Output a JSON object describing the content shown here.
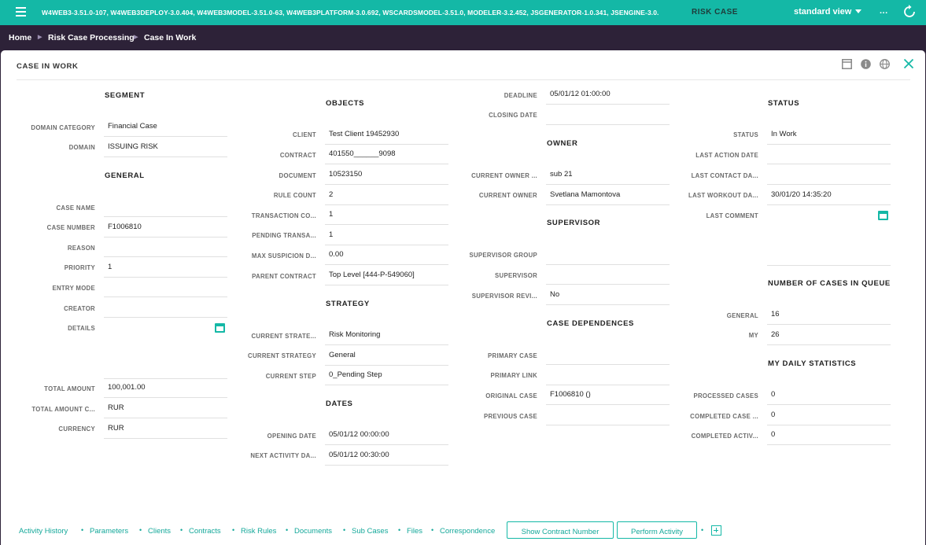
{
  "topbar": {
    "versions": "W4WEB3-3.51.0-107, W4WEB3DEPLOY-3.0.404, W4WEB3MODEL-3.51.0-63, W4WEB3PLATFORM-3.0.692, WSCARDSMODEL-3.51.0, MODELER-3.2.452, JSGENERATOR-1.0.341, JSENGINE-3.0.",
    "app_title": "RISK CASE",
    "view": "standard view",
    "more": "...",
    "menu_icon": "hamburger-icon",
    "refresh_icon": "refresh-icon"
  },
  "breadcrumb": [
    "Home",
    "Risk Case Processing",
    "Case In Work"
  ],
  "panel": {
    "title": "CASE IN WORK",
    "icons": [
      "window-icon",
      "info-icon",
      "globe-icon",
      "close-icon"
    ]
  },
  "col1": {
    "segment_title": "SEGMENT",
    "domain_category_label": "DOMAIN CATEGORY",
    "domain_category": "Financial Case",
    "domain_label": "DOMAIN",
    "domain": "ISSUING RISK",
    "general_title": "GENERAL",
    "case_name_label": "CASE NAME",
    "case_name": "",
    "case_number_label": "CASE NUMBER",
    "case_number": "F1006810",
    "reason_label": "REASON",
    "reason": "",
    "priority_label": "PRIORITY",
    "priority": "1",
    "entry_mode_label": "ENTRY MODE",
    "entry_mode": "",
    "creator_label": "CREATOR",
    "creator": "",
    "details_label": "DETAILS",
    "details": "",
    "total_amount_label": "TOTAL AMOUNT",
    "total_amount": "100,001.00",
    "total_amount_c_label": "TOTAL AMOUNT C...",
    "total_amount_c": "RUR",
    "currency_label": "CURRENCY",
    "currency": "RUR"
  },
  "col2": {
    "objects_title": "OBJECTS",
    "client_label": "CLIENT",
    "client": "Test Client 19452930",
    "contract_label": "CONTRACT",
    "contract": "401550______9098",
    "document_label": "DOCUMENT",
    "document": "10523150",
    "rule_count_label": "RULE COUNT",
    "rule_count": "2",
    "transaction_co_label": "TRANSACTION CO...",
    "transaction_co": "1",
    "pending_transa_label": "PENDING TRANSA...",
    "pending_transa": "1",
    "max_suspicion_label": "MAX SUSPICION D...",
    "max_suspicion": "0.00",
    "parent_contract_label": "PARENT CONTRACT",
    "parent_contract": "Top Level [444-P-549060]",
    "strategy_title": "STRATEGY",
    "current_strate_label": "CURRENT STRATE...",
    "current_strate": "Risk Monitoring",
    "current_strategy_label": "CURRENT STRATEGY",
    "current_strategy": "General",
    "current_step_label": "CURRENT STEP",
    "current_step": "0_Pending Step",
    "dates_title": "DATES",
    "opening_date_label": "OPENING DATE",
    "opening_date": "05/01/12 00:00:00",
    "next_activity_label": "NEXT ACTIVITY DA...",
    "next_activity": "05/01/12 00:30:00"
  },
  "col3": {
    "deadline_label": "DEADLINE",
    "deadline": "05/01/12 01:00:00",
    "closing_date_label": "CLOSING DATE",
    "closing_date": "",
    "owner_title": "OWNER",
    "current_owner_g_label": "CURRENT OWNER ...",
    "current_owner_g": "sub 21",
    "current_owner_label": "CURRENT OWNER",
    "current_owner": "Svetlana Mamontova",
    "supervisor_title": "SUPERVISOR",
    "supervisor_group_label": "SUPERVISOR GROUP",
    "supervisor_group": "",
    "supervisor_label": "SUPERVISOR",
    "supervisor": "",
    "supervisor_revi_label": "SUPERVISOR REVI...",
    "supervisor_revi": "No",
    "case_dependences_title": "CASE DEPENDENCES",
    "primary_case_label": "PRIMARY CASE",
    "primary_case": "",
    "primary_link_label": "PRIMARY LINK",
    "primary_link": "",
    "original_case_label": "ORIGINAL CASE",
    "original_case": "F1006810 ()",
    "previous_case_label": "PREVIOUS CASE",
    "previous_case": ""
  },
  "col4": {
    "status_title": "STATUS",
    "status_label": "STATUS",
    "status": "In Work",
    "last_action_label": "LAST ACTION DATE",
    "last_action": "",
    "last_contact_label": "LAST CONTACT DA...",
    "last_contact": "",
    "last_workout_label": "LAST WORKOUT DA...",
    "last_workout": "30/01/20 14:35:20",
    "last_comment_label": "LAST COMMENT",
    "last_comment": "",
    "queue_title": "NUMBER OF CASES IN QUEUE",
    "queue_general_label": "GENERAL",
    "queue_general": "16",
    "queue_my_label": "MY",
    "queue_my": "26",
    "daily_title": "MY DAILY STATISTICS",
    "processed_label": "PROCESSED CASES",
    "processed": "0",
    "completed_case_label": "COMPLETED CASE ...",
    "completed_case": "0",
    "completed_activ_label": "COMPLETED ACTIV...",
    "completed_activ": "0"
  },
  "bottom": {
    "links": [
      "Activity History",
      "Parameters",
      "Clients",
      "Contracts",
      "Risk Rules",
      "Documents",
      "Sub Cases",
      "Files",
      "Correspondence"
    ],
    "separator": "•",
    "show_contract_number": "Show Contract Number",
    "perform_activity": "Perform Activity",
    "add_icon": "plus-square-icon"
  },
  "colors": {
    "accent": "#14b8a6",
    "header_dark": "#2d2238"
  }
}
